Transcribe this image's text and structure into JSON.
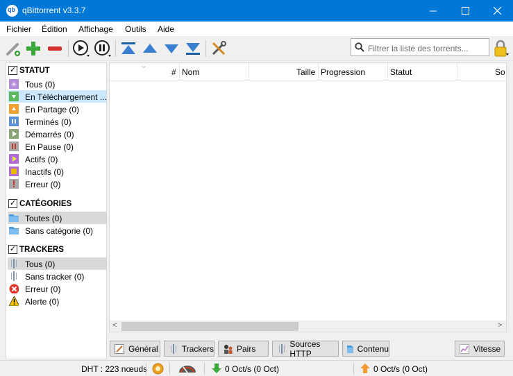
{
  "window": {
    "title": "qBittorrent v3.3.7"
  },
  "menu": [
    "Fichier",
    "Édition",
    "Affichage",
    "Outils",
    "Aide"
  ],
  "toolbar": {
    "icons": [
      "add-link-icon",
      "add-torrent-icon",
      "remove-icon",
      "resume-icon",
      "pause-icon",
      "move-top-icon",
      "move-up-icon",
      "move-down-icon",
      "move-bottom-icon",
      "options-icon"
    ],
    "search_placeholder": "Filtrer la liste des torrents..."
  },
  "sidebar": {
    "status": {
      "heading": "STATUT",
      "items": [
        {
          "label": "Tous (0)",
          "icon": "all-icon",
          "color": "#b38cd9"
        },
        {
          "label": "En Téléchargement ...",
          "icon": "downloading-icon",
          "color": "#5cb85c"
        },
        {
          "label": "En Partage (0)",
          "icon": "seeding-icon",
          "color": "#f0a030"
        },
        {
          "label": "Terminés (0)",
          "icon": "completed-icon",
          "color": "#5b8fd6"
        },
        {
          "label": "Démarrés (0)",
          "icon": "resumed-icon",
          "color": "#8aa57a"
        },
        {
          "label": "En Pause (0)",
          "icon": "paused-icon",
          "color": "#c0392b"
        },
        {
          "label": "Actifs (0)",
          "icon": "active-icon",
          "color": "#b36ad9"
        },
        {
          "label": "Inactifs (0)",
          "icon": "inactive-icon",
          "color": "#e6b800"
        },
        {
          "label": "Erreur (0)",
          "icon": "error-icon",
          "color": "#c0392b"
        }
      ]
    },
    "categories": {
      "heading": "CATÉGORIES",
      "items": [
        {
          "label": "Toutes (0)",
          "icon": "folder-icon"
        },
        {
          "label": "Sans catégorie (0)",
          "icon": "folder-icon"
        }
      ]
    },
    "trackers": {
      "heading": "TRACKERS",
      "items": [
        {
          "label": "Tous (0)",
          "icon": "tracker-icon"
        },
        {
          "label": "Sans tracker (0)",
          "icon": "tracker-icon"
        },
        {
          "label": "Erreur (0)",
          "icon": "error-circle-icon"
        },
        {
          "label": "Alerte (0)",
          "icon": "warning-icon"
        }
      ]
    }
  },
  "table": {
    "columns": [
      "#",
      "Nom",
      "Taille",
      "Progression",
      "Statut",
      "So"
    ]
  },
  "tabs": [
    {
      "label": "Général",
      "icon": "general-icon"
    },
    {
      "label": "Trackers",
      "icon": "trackers-icon"
    },
    {
      "label": "Pairs",
      "icon": "peers-icon"
    },
    {
      "label": "Sources HTTP",
      "icon": "http-sources-icon"
    },
    {
      "label": "Contenu",
      "icon": "content-icon"
    },
    {
      "label": "Vitesse",
      "icon": "speed-icon"
    }
  ],
  "status": {
    "dht": "DHT : 223 nœuds",
    "download": "0 Oct/s (0 Oct)",
    "upload": "0 Oct/s (0 Oct)"
  }
}
